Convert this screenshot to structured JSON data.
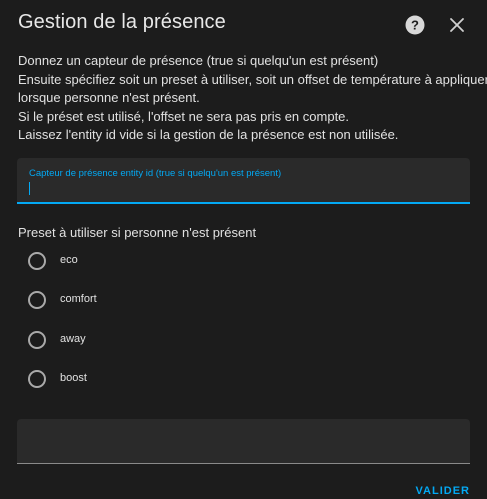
{
  "dialog": {
    "title": "Gestion de la présence",
    "description": [
      "Donnez un capteur de présence (true si quelqu'un est présent)",
      "Ensuite spécifiez soit un preset à utiliser, soit un offset de température à appliquer",
      "lorsque personne n'est présent.",
      "Si le préset est utilisé, l'offset ne sera pas pris en compte.",
      "Laissez l'entity id vide si la gestion de la présence est non utilisée."
    ],
    "presence_field": {
      "label": "Capteur de présence entity id (true si quelqu'un est présent)",
      "value": ""
    },
    "preset_label": "Preset à utiliser si personne n'est présent",
    "presets": [
      {
        "label": "eco",
        "selected": false
      },
      {
        "label": "comfort",
        "selected": false
      },
      {
        "label": "away",
        "selected": false
      },
      {
        "label": "boost",
        "selected": false
      }
    ],
    "submit_label": "VALIDER",
    "help_icon": "help-circle-icon",
    "close_icon": "close-icon",
    "accent_color": "#03a9f4"
  }
}
